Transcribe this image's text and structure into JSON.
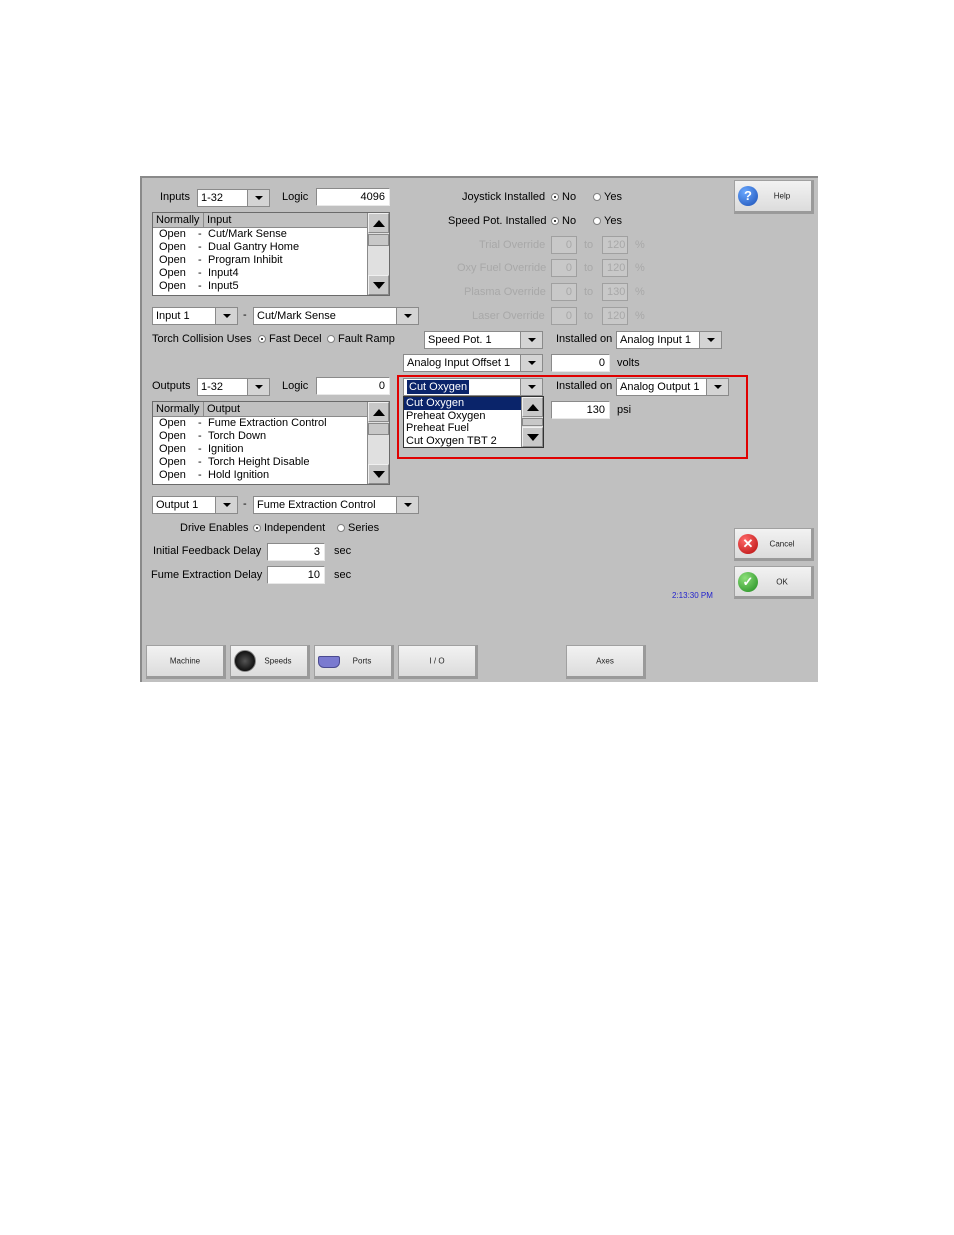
{
  "inputs": {
    "label": "Inputs",
    "range": "1-32",
    "logic_label": "Logic",
    "logic_value": "4096",
    "list_headers": [
      "Normally",
      "Input"
    ],
    "rows": [
      {
        "state": "Open",
        "name": "Cut/Mark Sense"
      },
      {
        "state": "Open",
        "name": "Dual Gantry Home"
      },
      {
        "state": "Open",
        "name": "Program Inhibit"
      },
      {
        "state": "Open",
        "name": "Input4"
      },
      {
        "state": "Open",
        "name": "Input5"
      }
    ],
    "selector": "Input 1",
    "dash": "-",
    "function": "Cut/Mark Sense"
  },
  "torch_collision": {
    "label": "Torch Collision Uses",
    "options": [
      "Fast Decel",
      "Fault Ramp"
    ],
    "selected": "Fast Decel"
  },
  "outputs": {
    "label": "Outputs",
    "range": "1-32",
    "logic_label": "Logic",
    "logic_value": "0",
    "list_headers": [
      "Normally",
      "Output"
    ],
    "rows": [
      {
        "state": "Open",
        "name": "Fume Extraction Control"
      },
      {
        "state": "Open",
        "name": "Torch Down"
      },
      {
        "state": "Open",
        "name": "Ignition"
      },
      {
        "state": "Open",
        "name": "Torch Height Disable"
      },
      {
        "state": "Open",
        "name": "Hold Ignition"
      }
    ],
    "selector": "Output 1",
    "dash": "-",
    "function": "Fume Extraction Control"
  },
  "drive_enables": {
    "label": "Drive Enables",
    "options": [
      "Independent",
      "Series"
    ],
    "selected": "Independent"
  },
  "initial_feedback_delay": {
    "label": "Initial Feedback Delay",
    "value": "3",
    "unit": "sec"
  },
  "fume_extraction_delay": {
    "label": "Fume Extraction Delay",
    "value": "10",
    "unit": "sec"
  },
  "joystick": {
    "label": "Joystick Installed",
    "options": [
      "No",
      "Yes"
    ],
    "selected": "No"
  },
  "speed_pot": {
    "label": "Speed Pot. Installed",
    "options": [
      "No",
      "Yes"
    ],
    "selected": "No"
  },
  "overrides": [
    {
      "label": "Trial Override",
      "min": "0",
      "to": "to",
      "max": "120",
      "unit": "%"
    },
    {
      "label": "Oxy Fuel Override",
      "min": "0",
      "to": "to",
      "max": "120",
      "unit": "%"
    },
    {
      "label": "Plasma Override",
      "min": "0",
      "to": "to",
      "max": "130",
      "unit": "%"
    },
    {
      "label": "Laser Override",
      "min": "0",
      "to": "to",
      "max": "120",
      "unit": "%"
    }
  ],
  "analog_in": {
    "device": "Speed Pot. 1",
    "installed_on_label": "Installed on",
    "installed_on": "Analog Input 1",
    "offset_select": "Analog Input Offset 1",
    "offset_value": "0",
    "offset_unit": "volts"
  },
  "analog_out": {
    "device": "Cut Oxygen",
    "installed_on_label": "Installed on",
    "installed_on": "Analog Output 1",
    "value": "130",
    "unit": "psi",
    "dropdown_options": [
      "Cut Oxygen",
      "Preheat Oxygen",
      "Preheat Fuel",
      "Cut Oxygen TBT 2"
    ],
    "dropdown_selected": "Cut Oxygen"
  },
  "buttons": {
    "help": "Help",
    "cancel": "Cancel",
    "ok": "OK"
  },
  "time": "2:13:30 PM",
  "tabs": [
    {
      "label": "Machine"
    },
    {
      "label": "Speeds"
    },
    {
      "label": "Ports"
    },
    {
      "label": "I / O"
    },
    {
      "label": "Axes"
    }
  ],
  "colors": {
    "highlight": "#e00000",
    "selection": "#0a246a",
    "time_text": "#2222cc"
  }
}
